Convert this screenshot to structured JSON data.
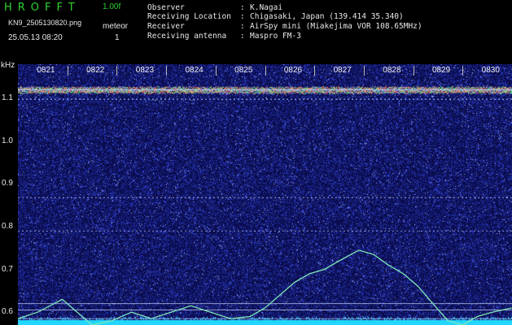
{
  "header": {
    "app_title": "HROFFT",
    "version": "1.00f",
    "filename": "KN9_2505130820.png",
    "mode_label": "meteor",
    "datetime": "25.05.13 08:20",
    "count": "1",
    "info": [
      {
        "label": "Observer",
        "value": "K.Nagai"
      },
      {
        "label": "Receiving Location",
        "value": "Chigasaki, Japan (139.414 35.340)"
      },
      {
        "label": "Receiver",
        "value": "AirSpy mini (Miakejima VOR 108.65MHz)"
      },
      {
        "label": "Receiving antenna",
        "value": "Maspro FM-3"
      }
    ]
  },
  "chart_data": {
    "type": "heatmap",
    "yunit": "kHz",
    "xticks": [
      "0821",
      "0822",
      "0823",
      "0824",
      "0825",
      "0826",
      "0827",
      "0828",
      "0829",
      "0830"
    ],
    "yticks": [
      "1.1",
      "1.0",
      "0.9",
      "0.8",
      "0.7",
      "0.6"
    ],
    "ylim": [
      0.57,
      1.18
    ],
    "horizontal_lines_khz": [
      1.12,
      1.098,
      0.868,
      0.79,
      0.62,
      0.605,
      0.585
    ],
    "trace": {
      "color": "#7fe6b8",
      "points": [
        [
          0,
          0.585
        ],
        [
          0.4,
          0.6
        ],
        [
          0.9,
          0.63
        ],
        [
          1.1,
          0.61
        ],
        [
          1.5,
          0.57
        ],
        [
          1.9,
          0.58
        ],
        [
          2.3,
          0.6
        ],
        [
          2.7,
          0.585
        ],
        [
          3.1,
          0.6
        ],
        [
          3.5,
          0.615
        ],
        [
          3.9,
          0.6
        ],
        [
          4.3,
          0.585
        ],
        [
          4.7,
          0.59
        ],
        [
          5.0,
          0.61
        ],
        [
          5.3,
          0.64
        ],
        [
          5.6,
          0.67
        ],
        [
          5.9,
          0.69
        ],
        [
          6.2,
          0.7
        ],
        [
          6.5,
          0.72
        ],
        [
          6.9,
          0.745
        ],
        [
          7.2,
          0.735
        ],
        [
          7.5,
          0.71
        ],
        [
          7.8,
          0.69
        ],
        [
          8.1,
          0.66
        ],
        [
          8.4,
          0.62
        ],
        [
          8.7,
          0.58
        ],
        [
          9.0,
          0.57
        ],
        [
          9.3,
          0.59
        ],
        [
          9.6,
          0.6
        ],
        [
          10,
          0.61
        ]
      ]
    },
    "colors": {
      "background": "#0a0c4e",
      "noise": "#2c3cc8",
      "line": "#c8d8ff",
      "band": "#ff5a5a",
      "floor": "#23d6ff"
    }
  }
}
